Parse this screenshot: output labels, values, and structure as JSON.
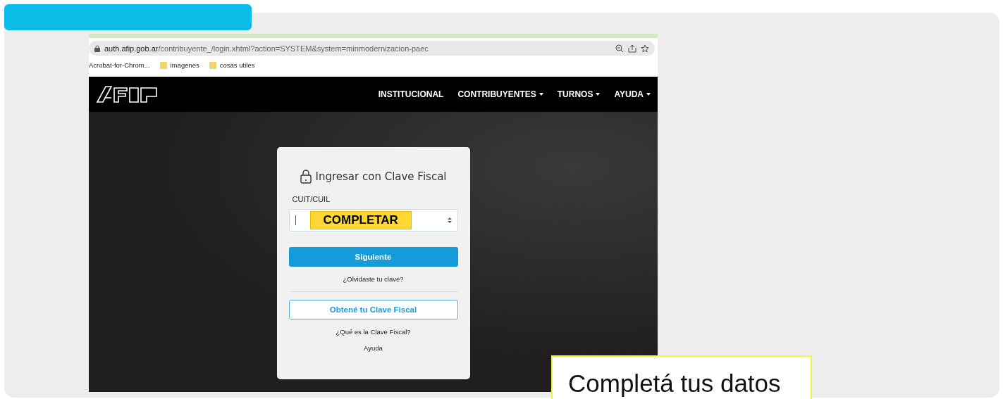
{
  "browser": {
    "url_host": "auth.afip.gob.ar",
    "url_path": "/contribuyente_/login.xhtml?action=SYSTEM&system=minmodernizacion-paec",
    "bookmarks": [
      {
        "label": "Acrobat-for-Chrom...",
        "kind": "plain"
      },
      {
        "label": "imagenes",
        "kind": "folder"
      },
      {
        "label": "cosas utiles",
        "kind": "folder"
      }
    ]
  },
  "site_nav": [
    {
      "label": "INSTITUCIONAL",
      "dropdown": false
    },
    {
      "label": "CONTRIBUYENTES",
      "dropdown": true
    },
    {
      "label": "TURNOS",
      "dropdown": true
    },
    {
      "label": "AYUDA",
      "dropdown": true
    }
  ],
  "login": {
    "title": "Ingresar con Clave Fiscal",
    "field_label": "CUIT/CUIL",
    "highlight": "COMPLETAR",
    "primary_button": "Siguiente",
    "forgot_link": "¿Olvidaste tu clave?",
    "secondary_button": "Obtené tu Clave Fiscal",
    "links": [
      "¿Qué es la Clave Fiscal?",
      "Ayuda"
    ]
  },
  "caption": "Completá tus datos"
}
